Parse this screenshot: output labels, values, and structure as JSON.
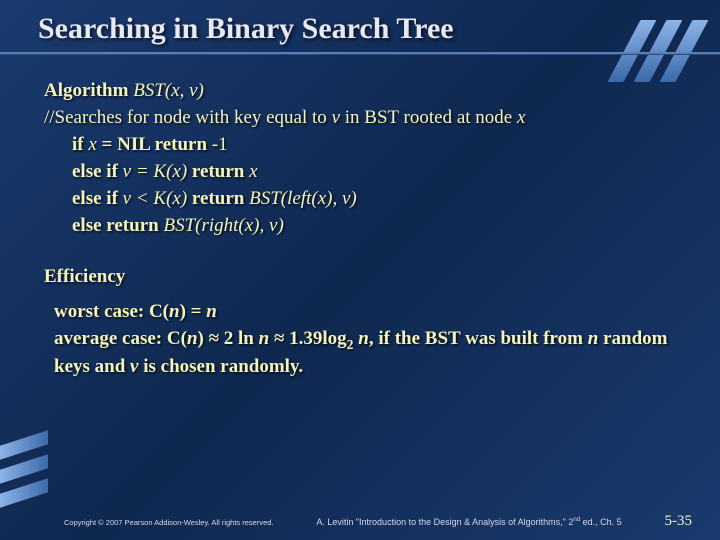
{
  "title": "Searching in Binary Search Tree",
  "algorithm": {
    "header_pre": "Algorithm ",
    "header_call": "BST(x, v)",
    "comment_pre": "//Searches for node with key equal to ",
    "comment_v": "v",
    "comment_mid": " in BST rooted at node ",
    "comment_x": "x",
    "line1_a": "if ",
    "line1_b": "x",
    "line1_c": " = NIL  return ",
    "line1_d": "-1",
    "line2_a": "else if  ",
    "line2_b": "v = K(x)",
    "line2_c": "  return ",
    "line2_d": "x",
    "line3_a": "else if  ",
    "line3_b": "v < K(x)",
    "line3_c": "  return ",
    "line3_d": "BST(left(x), v)",
    "line4_a": "else return ",
    "line4_b": "BST(right(x), v)"
  },
  "efficiency": {
    "heading": "Efficiency",
    "worst_label": "worst case:    C(",
    "worst_n": "n",
    "worst_eq": ") = ",
    "worst_rhs": "n",
    "avg_label": "average case: C(",
    "avg_n1": "n",
    "avg_mid1": ") ≈ 2 ln ",
    "avg_n2": "n",
    "avg_mid2": " ≈ 1.39log",
    "avg_sub": "2",
    "avg_sp": " ",
    "avg_n3": "n",
    "avg_tail1": ",  if the BST was built from ",
    "avg_n4": "n",
    "avg_tail2": " random keys and ",
    "avg_v": "v",
    "avg_tail3": " is chosen randomly."
  },
  "footer": {
    "copyright": "Copyright © 2007 Pearson Addison-Wesley. All rights reserved.",
    "citation_pre": "A. Levitin \"Introduction to the Design & Analysis of Algorithms,\" 2",
    "citation_sup": "nd",
    "citation_post": " ed., Ch. 5",
    "page": "5-35"
  }
}
